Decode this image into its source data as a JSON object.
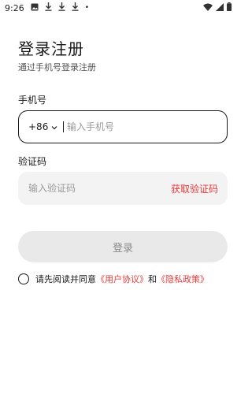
{
  "status_bar": {
    "time": "9:26",
    "dot": "•",
    "icons": [
      "image-icon",
      "download-icon",
      "download-icon",
      "download-icon",
      "wifi-icon",
      "signal-icon",
      "battery-icon"
    ]
  },
  "header": {
    "title": "登录注册",
    "subtitle": "通过手机号登录注册"
  },
  "phone": {
    "label": "手机号",
    "country_code": "+86",
    "placeholder": "输入手机号",
    "value": ""
  },
  "code": {
    "label": "验证码",
    "placeholder": "输入验证码",
    "value": "",
    "get_code_label": "获取验证码"
  },
  "login": {
    "label": "登录"
  },
  "agreement": {
    "prefix": "请先阅读并同意",
    "user_agreement": "《用户协议》",
    "and": "和",
    "privacy_policy": "《隐私政策》",
    "checked": false
  },
  "colors": {
    "accent": "#e83a3a",
    "button_bg": "#e9e9e9",
    "field_bg": "#f3f3f3"
  }
}
